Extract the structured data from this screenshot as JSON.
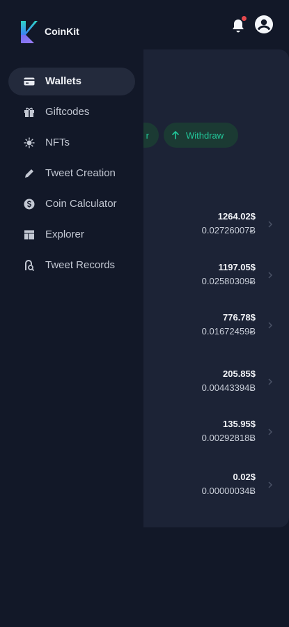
{
  "app": {
    "name": "CoinKit"
  },
  "actions": {
    "transfer_fragment": "r",
    "withdraw_label": "Withdraw"
  },
  "nav": {
    "items": [
      {
        "label": "Wallets",
        "icon": "wallet-icon",
        "active": true
      },
      {
        "label": "Giftcodes",
        "icon": "gift-icon"
      },
      {
        "label": "NFTs",
        "icon": "nft-icon"
      },
      {
        "label": "Tweet Creation",
        "icon": "pencil-icon"
      },
      {
        "label": "Coin Calculator",
        "icon": "dollar-coin-icon"
      },
      {
        "label": "Explorer",
        "icon": "explorer-icon"
      },
      {
        "label": "Tweet Records",
        "icon": "records-icon"
      }
    ]
  },
  "wallets": [
    {
      "usd": "1264.02$",
      "btc": "0.02726007Ƀ"
    },
    {
      "usd": "1197.05$",
      "btc": "0.02580309Ƀ"
    },
    {
      "usd": "776.78$",
      "btc": "0.01672459Ƀ"
    },
    {
      "usd": "205.85$",
      "btc": "0.00443394Ƀ"
    },
    {
      "usd": "135.95$",
      "btc": "0.00292818Ƀ"
    },
    {
      "usd": "0.02$",
      "btc": "0.00000034Ƀ"
    }
  ],
  "colors": {
    "accent": "#22c79a",
    "background": "#121828",
    "card": "#1c2336",
    "notification": "#e5484d"
  }
}
